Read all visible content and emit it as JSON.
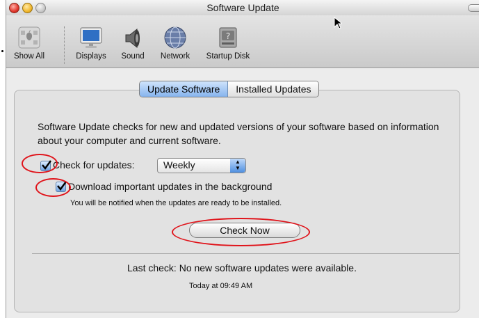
{
  "window": {
    "title": "Software Update"
  },
  "toolbar": {
    "items": [
      {
        "label": "Show All",
        "icon": "apple-grid-icon"
      },
      {
        "label": "Displays",
        "icon": "display-icon"
      },
      {
        "label": "Sound",
        "icon": "speaker-icon"
      },
      {
        "label": "Network",
        "icon": "globe-icon"
      },
      {
        "label": "Startup Disk",
        "icon": "disk-icon"
      }
    ]
  },
  "tabs": [
    {
      "label": "Update Software",
      "selected": true
    },
    {
      "label": "Installed Updates",
      "selected": false
    }
  ],
  "main": {
    "description": "Software Update checks for new and updated versions of your software based on information about your computer and current software.",
    "check_label": "Check for updates:",
    "check_checked": true,
    "frequency_value": "Weekly",
    "download_label": "Download important updates in the background",
    "download_checked": true,
    "download_note": "You will be notified when the updates are ready to be installed.",
    "check_now_label": "Check Now",
    "last_check": "Last check: No new software updates were available.",
    "last_check_time": "Today at 09:49 AM"
  },
  "colors": {
    "annotation": "#e0141b",
    "accent": "#6fa3e3"
  }
}
